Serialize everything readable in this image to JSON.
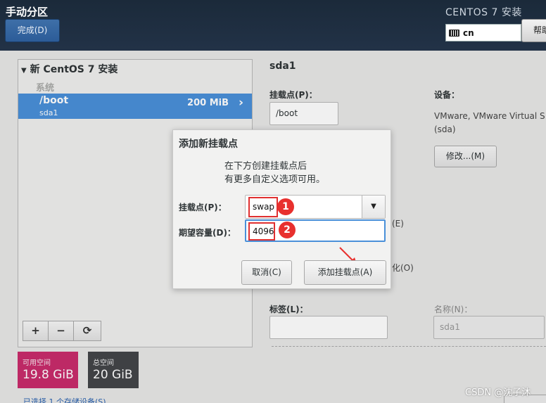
{
  "header": {
    "spoke_title": "手动分区",
    "done_button": "完成(D)",
    "product_title": "CENTOS 7 安装",
    "keyboard_layout": "cn",
    "help_button": "帮助"
  },
  "left_panel": {
    "install_title": "新 CentOS 7 安装",
    "category": "系统",
    "partitions": [
      {
        "mount": "/boot",
        "device": "sda1",
        "size": "200 MiB",
        "selected": true
      }
    ],
    "toolbar": {
      "add": "+",
      "remove": "−",
      "refresh": "⟳"
    }
  },
  "space": {
    "available_label": "可用空间",
    "available_value": "19.8 GiB",
    "total_label": "总空间",
    "total_value": "20 GiB",
    "available_color": "#c92c6c",
    "total_color": "#434649"
  },
  "storage_link": "已选择 1 个存储设备(S)",
  "right_panel": {
    "title": "sda1",
    "mount_label": "挂载点(P)：",
    "mount_value": "/boot",
    "device_label": "设备：",
    "device_line1": "VMware, VMware Virtual S",
    "device_line2": "(sda)",
    "modify_button": "修改...(M)",
    "peek_encrypt": "(E)",
    "peek_reformat": "化(O)",
    "tag_label": "标签(L)：",
    "tag_value": "",
    "name_label": "名称(N)：",
    "name_value": "sda1"
  },
  "dialog": {
    "title": "添加新挂载点",
    "description_line1": "在下方创建挂载点后",
    "description_line2": "有更多自定义选项可用。",
    "mount_label": "挂载点(P)：",
    "mount_value": "swap",
    "capacity_label": "期望容量(D)：",
    "capacity_value": "4096",
    "cancel_button": "取消(C)",
    "add_button": "添加挂载点(A)"
  },
  "annotations": {
    "badge1": "1",
    "badge2": "2",
    "color": "#e8302e"
  },
  "watermark": "CSDN @沈子沐"
}
